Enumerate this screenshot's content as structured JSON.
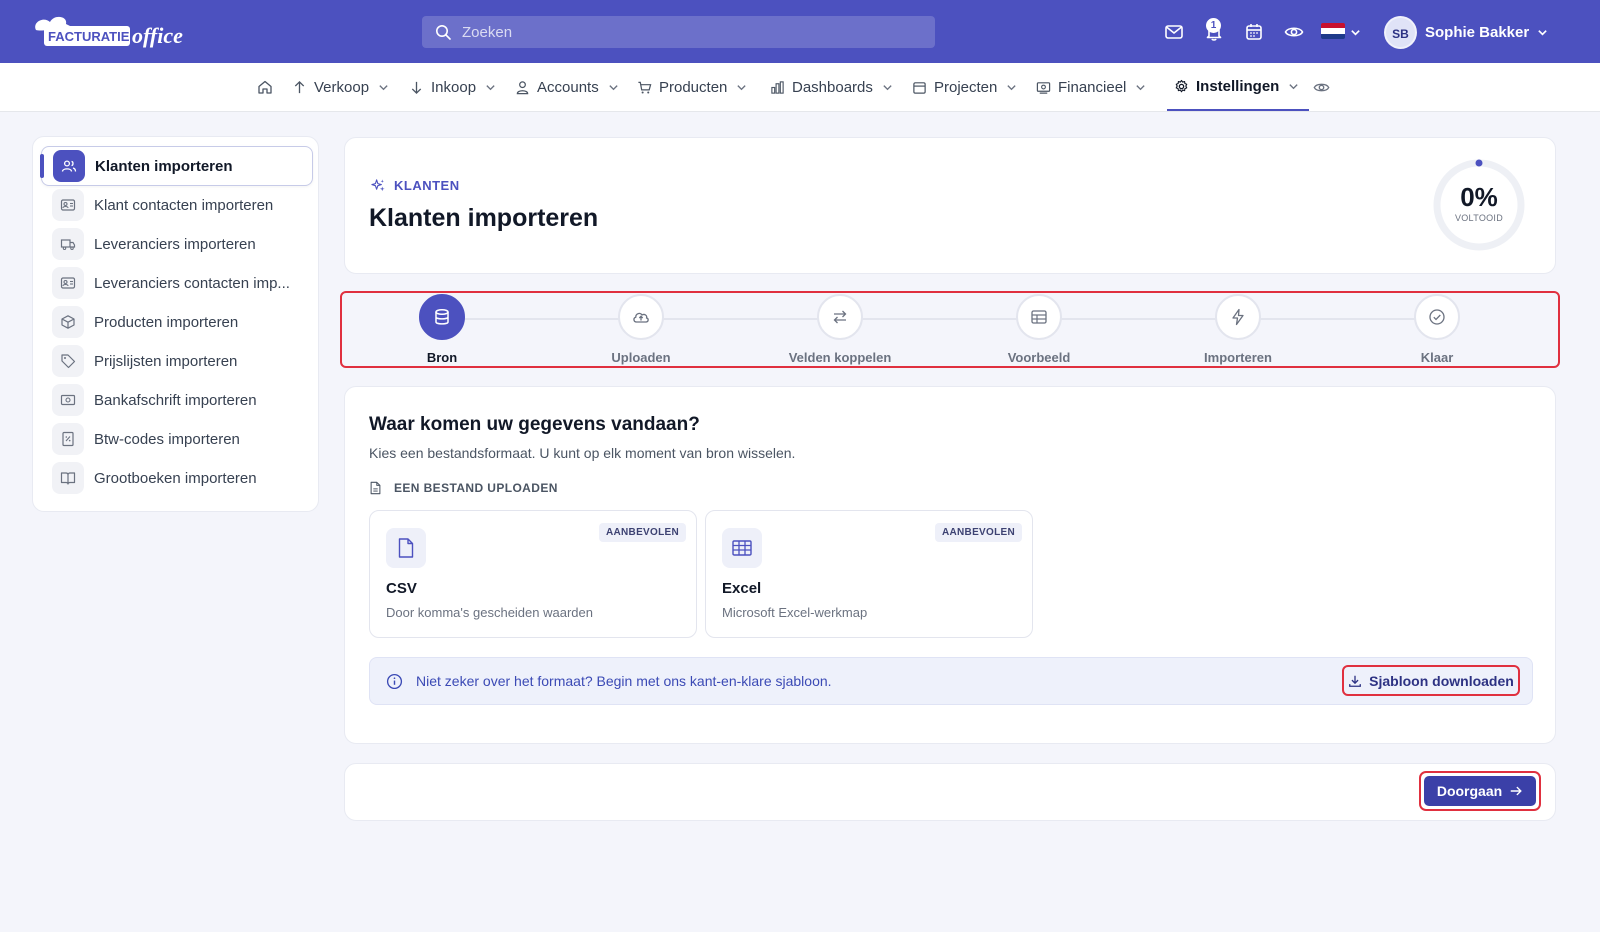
{
  "brand": {
    "logo_word1": "FACTURATIE",
    "logo_word2": "office"
  },
  "search": {
    "placeholder": "Zoeken"
  },
  "topbar": {
    "notification_count": "1",
    "user_initials": "SB",
    "user_name": "Sophie Bakker"
  },
  "nav": {
    "items": [
      {
        "label": "Verkoop",
        "icon": "arrow-up-icon"
      },
      {
        "label": "Inkoop",
        "icon": "arrow-down-icon"
      },
      {
        "label": "Accounts",
        "icon": "user-icon"
      },
      {
        "label": "Producten",
        "icon": "cart-icon"
      },
      {
        "label": "Dashboards",
        "icon": "bar-chart-icon"
      },
      {
        "label": "Projecten",
        "icon": "folder-icon"
      },
      {
        "label": "Financieel",
        "icon": "money-icon"
      },
      {
        "label": "Instellingen",
        "icon": "gear-icon",
        "active": true
      }
    ]
  },
  "sidebar": {
    "items": [
      {
        "label": "Klanten importeren",
        "icon": "users-icon",
        "active": true
      },
      {
        "label": "Klant contacten importeren",
        "icon": "contact-card-icon"
      },
      {
        "label": "Leveranciers importeren",
        "icon": "truck-icon"
      },
      {
        "label": "Leveranciers contacten imp...",
        "icon": "contact-card-icon"
      },
      {
        "label": "Producten importeren",
        "icon": "box-icon"
      },
      {
        "label": "Prijslijsten importeren",
        "icon": "tag-icon"
      },
      {
        "label": "Bankafschrift importeren",
        "icon": "banknote-icon"
      },
      {
        "label": "Btw-codes importeren",
        "icon": "percent-file-icon"
      },
      {
        "label": "Grootboeken importeren",
        "icon": "book-icon"
      }
    ]
  },
  "header": {
    "eyebrow": "KLANTEN",
    "title": "Klanten importeren",
    "progress_value": "0%",
    "progress_label": "VOLTOOID",
    "progress_fraction": 0
  },
  "stepper": {
    "steps": [
      {
        "label": "Bron",
        "icon": "database-icon",
        "active": true
      },
      {
        "label": "Uploaden",
        "icon": "cloud-upload-icon"
      },
      {
        "label": "Velden koppelen",
        "icon": "arrows-swap-icon"
      },
      {
        "label": "Voorbeeld",
        "icon": "table-icon"
      },
      {
        "label": "Importeren",
        "icon": "lightning-icon"
      },
      {
        "label": "Klaar",
        "icon": "check-circle-icon"
      }
    ]
  },
  "source": {
    "title": "Waar komen uw gegevens vandaan?",
    "subtitle": "Kies een bestandsformaat. U kunt op elk moment van bron wisselen.",
    "upload_heading": "EEN BESTAND UPLOADEN",
    "formats": [
      {
        "name": "CSV",
        "description": "Door komma's gescheiden waarden",
        "badge": "AANBEVOLEN",
        "icon": "file-icon"
      },
      {
        "name": "Excel",
        "description": "Microsoft Excel-werkmap",
        "badge": "AANBEVOLEN",
        "icon": "spreadsheet-icon"
      }
    ],
    "hint_text": "Niet zeker over het formaat? Begin met ons kant-en-klare sjabloon.",
    "template_button": "Sjabloon downloaden"
  },
  "footer": {
    "continue_button": "Doorgaan"
  },
  "colors": {
    "brand": "#4c51bf",
    "highlight": "#e0303f",
    "background": "#f4f5fb"
  }
}
